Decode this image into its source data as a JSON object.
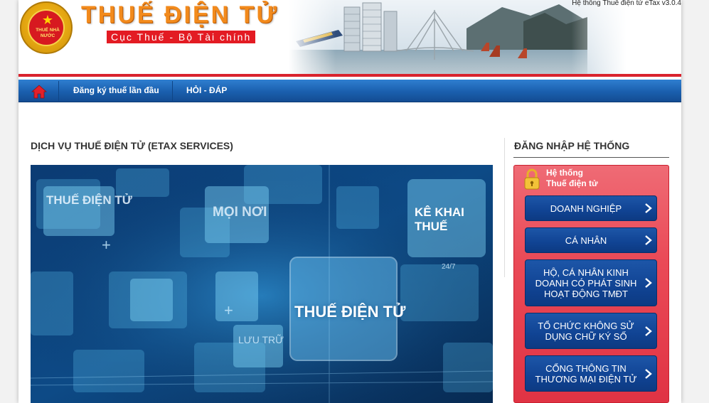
{
  "header": {
    "title": "THUẾ ĐIỆN TỬ",
    "subtitle": "Cục Thuế - Bộ Tài chính",
    "version": "Hệ thống Thuế điện tử eTax v3.0.4",
    "emblem_text": "THUẾ NHÀ NƯỚC"
  },
  "nav": {
    "items": [
      {
        "label": "Đăng ký thuế lần đầu"
      },
      {
        "label": "HỎI - ĐÁP"
      }
    ]
  },
  "main": {
    "title": "DỊCH VỤ THUẾ ĐIỆN TỬ (ETAX SERVICES)",
    "banner_labels": [
      "THUẾ ĐIỆN TỬ",
      "MỌI NƠI",
      "KÊ KHAI THUẾ",
      "THUẾ ĐIỆN TỬ",
      "LƯU TRỮ",
      "24/7"
    ]
  },
  "login": {
    "title": "ĐĂNG NHẬP HỆ THỐNG",
    "panel_head_line1": "Hệ thống",
    "panel_head_line2": "Thuế điện tử",
    "buttons": [
      {
        "label": "DOANH NGHIỆP"
      },
      {
        "label": "CÁ NHÂN"
      },
      {
        "label": "HỘ, CÁ NHÂN KINH DOANH CÓ PHÁT SINH HOẠT ĐỘNG TMĐT"
      },
      {
        "label": "TỔ CHỨC KHÔNG SỬ DỤNG CHỮ KÝ SỐ"
      },
      {
        "label": "CỔNG THÔNG TIN THƯƠNG MẠI ĐIỆN TỬ"
      }
    ]
  },
  "colors": {
    "nav_blue": "#1a5fae",
    "accent_red": "#e31b23",
    "title_orange": "#f28a1c",
    "button_blue": "#104393"
  },
  "icons": [
    "home-icon",
    "lock-icon",
    "chevron-right-icon"
  ]
}
